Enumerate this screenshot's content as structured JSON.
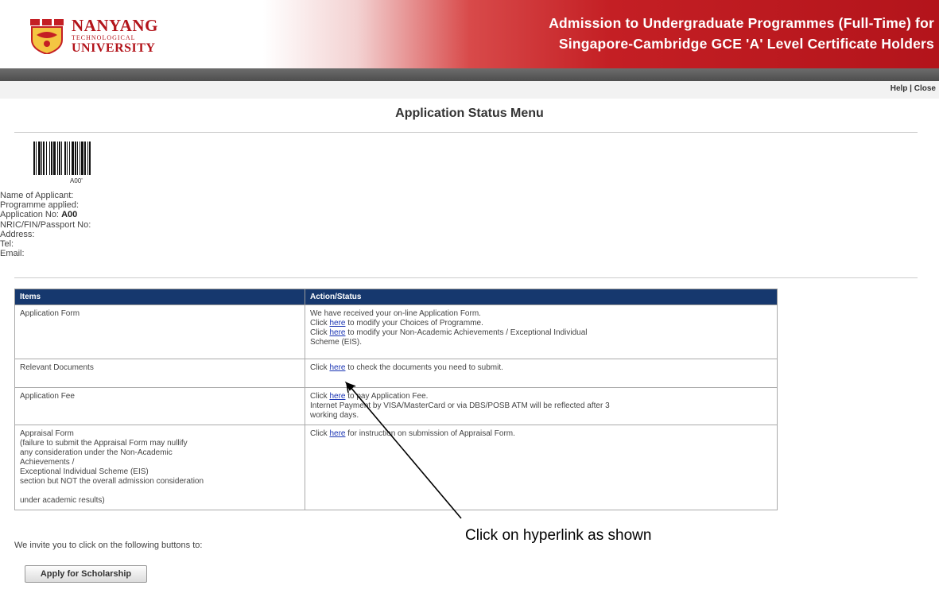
{
  "header": {
    "logo": {
      "line1": "NANYANG",
      "line2": "TECHNOLOGICAL",
      "line3": "UNIVERSITY"
    },
    "title_line1": "Admission to Undergraduate Programmes (Full-Time) for",
    "title_line2": "Singapore-Cambridge GCE 'A' Level Certificate Holders"
  },
  "top_links": {
    "help": "Help",
    "separator": " | ",
    "close": "Close"
  },
  "page_title": "Application Status Menu",
  "barcode": {
    "text": "A00'"
  },
  "applicant": {
    "name_label": "Name of Applicant:",
    "programme_label": "Programme applied:",
    "application_no_label": "Application No:",
    "application_no_value": "A00",
    "nric_label": "NRIC/FIN/Passport No:",
    "address_label": "Address:",
    "tel_label": "Tel:",
    "email_label": "Email:"
  },
  "table": {
    "headers": [
      "Items",
      "Action/Status"
    ],
    "rows": [
      {
        "item": "Application Form",
        "status": [
          {
            "pre": "We have received your on-line Application Form."
          },
          {
            "pre": "Click ",
            "link": "here",
            "post": " to modify your Choices of Programme."
          },
          {
            "pre": "Click ",
            "link": "here",
            "post": " to modify your Non-Academic Achievements / Exceptional Individual"
          },
          {
            "pre": "Scheme (EIS)."
          }
        ]
      },
      {
        "item": "Relevant Documents",
        "status": [
          {
            "pre": "Click ",
            "link": "here",
            "post": " to check the documents you need to submit."
          }
        ]
      },
      {
        "item": "Application Fee",
        "status": [
          {
            "pre": "Click ",
            "link": "here",
            "post": " to pay Application Fee."
          },
          {
            "pre": "Internet Payment by VISA/MasterCard or via DBS/POSB ATM will be reflected after 3"
          },
          {
            "pre": "working days."
          }
        ]
      },
      {
        "item_lines": [
          "Appraisal Form",
          "(failure to submit the Appraisal Form may nullify",
          "any consideration under the Non-Academic",
          "Achievements /",
          "Exceptional Individual Scheme (EIS)",
          "section but NOT the overall admission consideration",
          "",
          "under academic results)"
        ],
        "status": [
          {
            "pre": "Click ",
            "link": "here",
            "post": " for instruction on submission of Appraisal Form."
          }
        ]
      }
    ]
  },
  "invite_text": "We invite you to click on the following buttons to:",
  "scholarship_button": "Apply for Scholarship",
  "annotation": "Click on hyperlink as shown",
  "colors": {
    "header_red": "#c41f24",
    "table_header": "#16386e",
    "link": "#1a34b3"
  }
}
